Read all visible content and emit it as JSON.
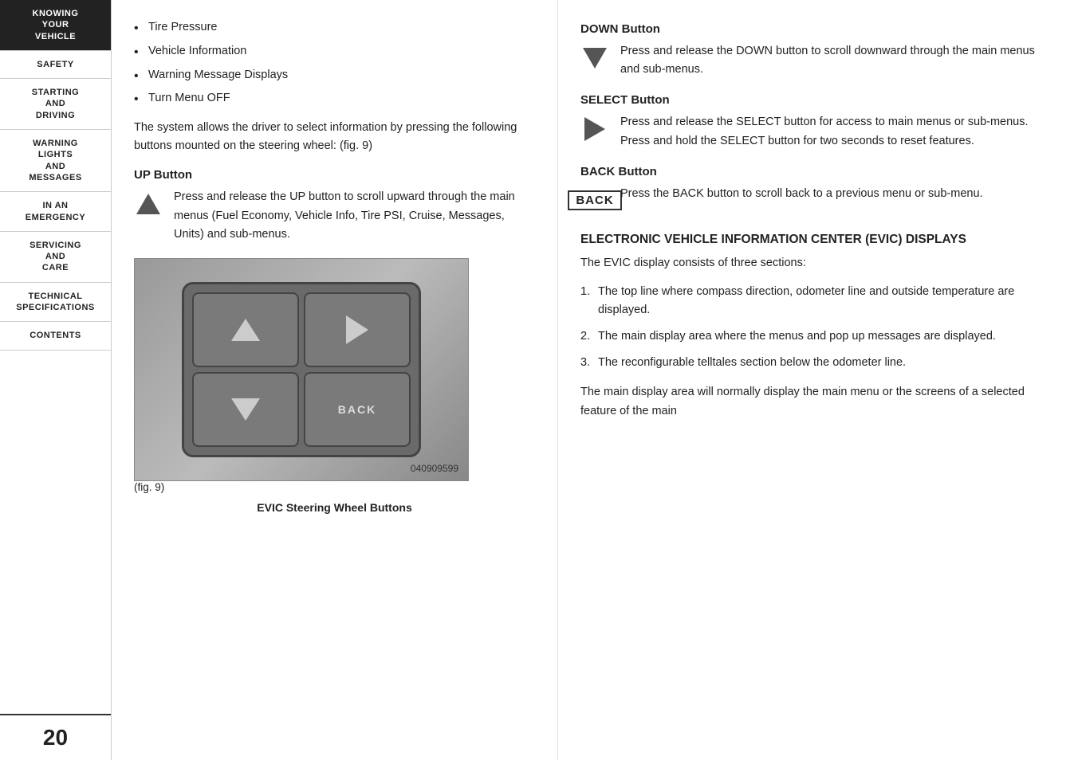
{
  "sidebar": {
    "items": [
      {
        "id": "knowing-your-vehicle",
        "label": "KNOWING\nYOUR\nVEHICLE",
        "active": true
      },
      {
        "id": "safety",
        "label": "SAFETY",
        "active": false
      },
      {
        "id": "starting-and-driving",
        "label": "STARTING\nAND\nDRIVING",
        "active": false
      },
      {
        "id": "warning-lights-and-messages",
        "label": "WARNING\nLIGHTS\nAND\nMESSAGES",
        "active": false
      },
      {
        "id": "in-an-emergency",
        "label": "IN AN\nEMERGENCY",
        "active": false
      },
      {
        "id": "servicing-and-care",
        "label": "SERVICING\nAND\nCARE",
        "active": false
      },
      {
        "id": "technical-specifications",
        "label": "TECHNICAL\nSPECIFICATIONS",
        "active": false
      },
      {
        "id": "contents",
        "label": "CONTENTS",
        "active": false
      }
    ],
    "page_number": "20"
  },
  "left_col": {
    "bullets": [
      "Tire Pressure",
      "Vehicle Information",
      "Warning Message Displays",
      "Turn Menu OFF"
    ],
    "intro": "The system allows the driver to select information by pressing the following buttons mounted on the steering wheel:  (fig. 9)",
    "up_button": {
      "heading": "UP Button",
      "description": "Press and release the UP button to scroll upward through the main menus (Fuel Economy, Vehicle Info, Tire PSI, Cruise, Messages, Units) and sub-menus."
    },
    "figure": {
      "caption_num": "040909599",
      "fig_ref": "(fig. 9)",
      "caption_label": "EVIC Steering Wheel Buttons"
    }
  },
  "right_col": {
    "down_button": {
      "heading": "DOWN Button",
      "description": "Press and release the DOWN button to scroll downward through the main menus and sub-menus."
    },
    "select_button": {
      "heading": "SELECT Button",
      "description": "Press and release the SELECT button for access to main menus or sub-menus. Press and hold the SELECT button for two seconds to reset features."
    },
    "back_button": {
      "heading": "BACK Button",
      "description": "Press the BACK button to scroll back to a previous menu or sub-menu.",
      "icon_label": "BACK"
    },
    "evic_section": {
      "heading": "ELECTRONIC VEHICLE INFORMATION CENTER (EVIC) DISPLAYS",
      "intro": "The EVIC display consists of three sections:",
      "items": [
        "The top line where compass direction, odometer line and outside temperature are displayed.",
        "The main display area where the menus and pop up messages are displayed.",
        "The reconfigurable telltales section below the odometer line."
      ],
      "footer": "The main display area will normally display the main menu or the screens of a selected feature of the main"
    }
  }
}
